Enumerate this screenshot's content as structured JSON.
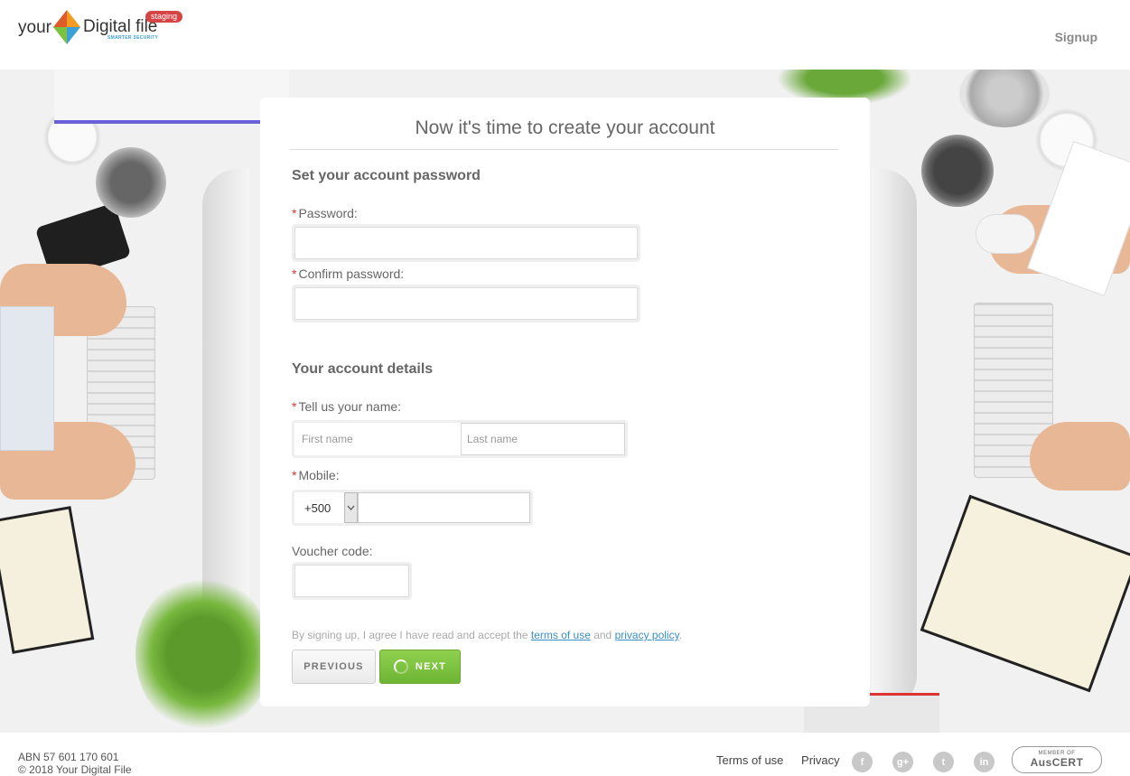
{
  "header": {
    "logo_your": "your",
    "logo_digital": "Digital file",
    "logo_tagline": "SMARTER SECURITY",
    "logo_badge": "staging",
    "signup_label": "Signup"
  },
  "form": {
    "title": "Now it's time to create your account",
    "password_section": "Set your account password",
    "password_label": "Password:",
    "confirm_label": "Confirm password:",
    "details_section": "Your account details",
    "name_label": "Tell us your name:",
    "first_placeholder": "First name",
    "last_placeholder": "Last name",
    "mobile_label": "Mobile:",
    "mobile_code": "+500",
    "voucher_label": "Voucher code:",
    "terms_prefix": "By signing up, I agree I have read and accept the ",
    "terms_link": "terms of use",
    "terms_and": " and ",
    "privacy_link": "privacy policy",
    "terms_suffix": ".",
    "required_marker": "*",
    "prev_label": "PREVIOUS",
    "next_label": "NEXT"
  },
  "footer": {
    "abn": "ABN 57 601 170 601",
    "copyright": "© 2018 Your Digital File",
    "terms_label": "Terms of use",
    "privacy_label": "Privacy",
    "social": [
      "f",
      "g+",
      "t",
      "in"
    ],
    "auscert_small": "MEMBER OF",
    "auscert_big": "AusCERT"
  },
  "colors": {
    "accent_green": "#7cc242",
    "required_red": "#d33333",
    "link_blue": "#3a8fc8",
    "staging_red": "#d64545"
  }
}
